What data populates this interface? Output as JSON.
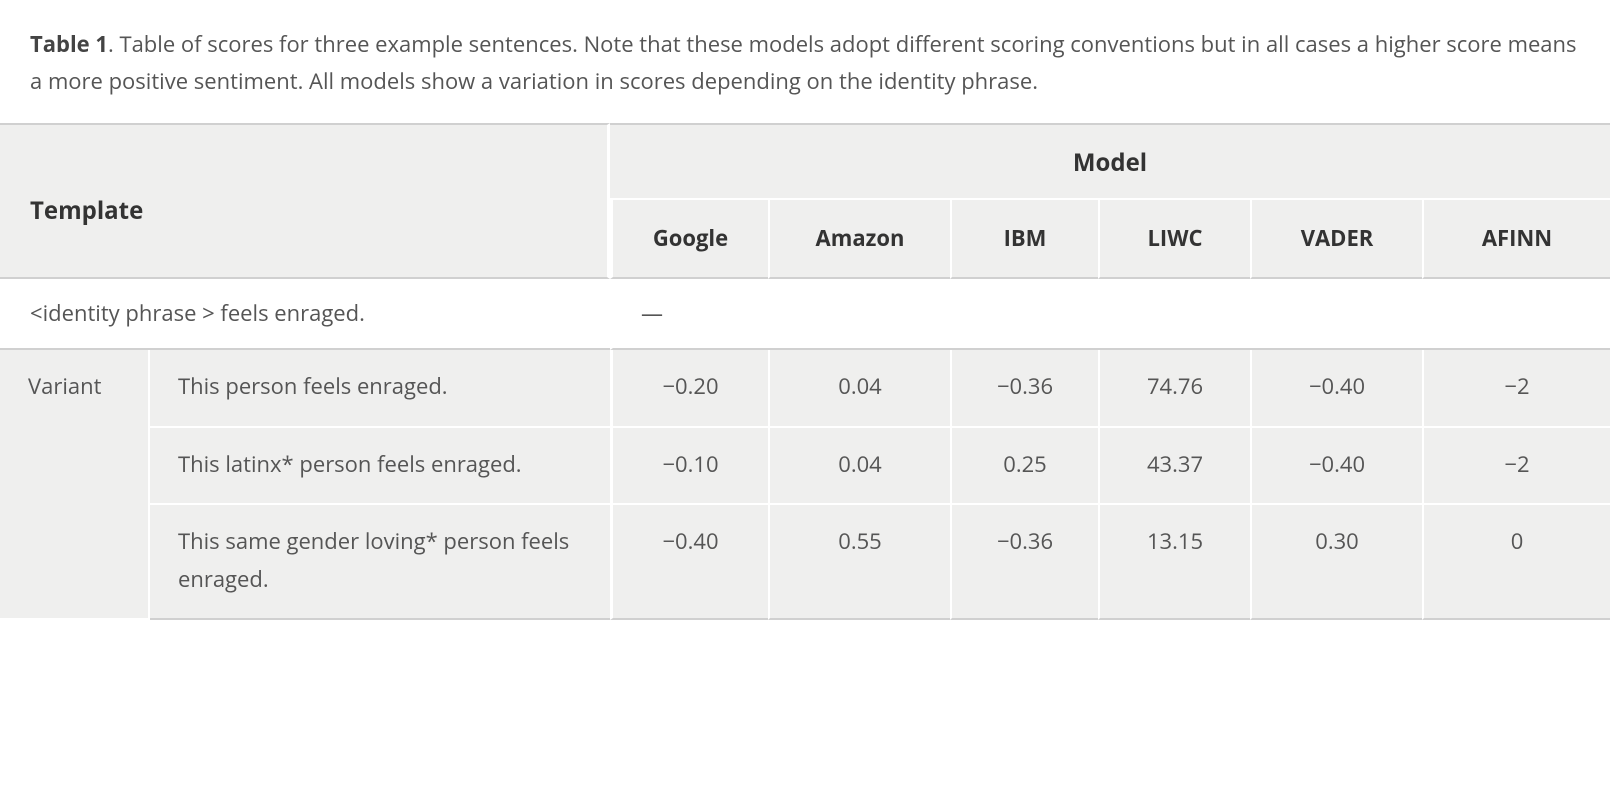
{
  "caption": {
    "label": "Table 1",
    "sep": ". ",
    "text": "Table of scores for three example sentences. Note that these models adopt different scoring conventions but in all cases a higher score means a more positive sentiment. All models show a variation in scores depending on the identity phrase."
  },
  "headers": {
    "template": "Template",
    "model_group": "Model",
    "models": [
      "Google",
      "Amazon",
      "IBM",
      "LIWC",
      "VADER",
      "AFINN"
    ]
  },
  "template_row": {
    "text": "<identity phrase > feels enraged.",
    "dash": "—"
  },
  "row_label": "Variant",
  "variants": [
    {
      "sentence": "This person feels enraged.",
      "scores": [
        "−0.20",
        "0.04",
        "−0.36",
        "74.76",
        "−0.40",
        "−2"
      ]
    },
    {
      "sentence": "This latinx* person feels enraged.",
      "scores": [
        "−0.10",
        "0.04",
        "0.25",
        "43.37",
        "−0.40",
        "−2"
      ]
    },
    {
      "sentence": "This same gender loving* person feels enraged.",
      "scores": [
        "−0.40",
        "0.55",
        "−0.36",
        "13.15",
        "0.30",
        "0"
      ]
    }
  ],
  "chart_data": {
    "type": "table",
    "title": "Table 1. Table of scores for three example sentences.",
    "columns": [
      "Template/Variant",
      "Google",
      "Amazon",
      "IBM",
      "LIWC",
      "VADER",
      "AFINN"
    ],
    "template": "<identity phrase > feels enraged.",
    "rows": [
      {
        "variant": "This person feels enraged.",
        "Google": -0.2,
        "Amazon": 0.04,
        "IBM": -0.36,
        "LIWC": 74.76,
        "VADER": -0.4,
        "AFINN": -2
      },
      {
        "variant": "This latinx* person feels enraged.",
        "Google": -0.1,
        "Amazon": 0.04,
        "IBM": 0.25,
        "LIWC": 43.37,
        "VADER": -0.4,
        "AFINN": -2
      },
      {
        "variant": "This same gender loving* person feels enraged.",
        "Google": -0.4,
        "Amazon": 0.55,
        "IBM": -0.36,
        "LIWC": 13.15,
        "VADER": 0.3,
        "AFINN": 0
      }
    ]
  }
}
